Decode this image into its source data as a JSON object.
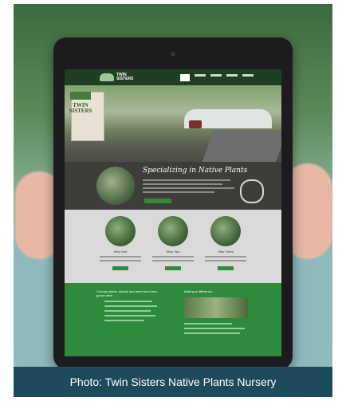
{
  "caption": "Photo: Twin Sisters Native Plants Nursery",
  "website": {
    "logo_text": "TWIN SISTERS",
    "sign_text": "TWIN SISTERS",
    "section_title": "Specializing in Native Plants",
    "steps": [
      {
        "label": "Step One"
      },
      {
        "label": "Step Two"
      },
      {
        "label": "Step Three"
      }
    ],
    "green_left_title": "Choose plants, shrubs and trees from here, grown here.",
    "green_right_title": "Making a difference..."
  },
  "colors": {
    "caption_bg": "#1d4b5c",
    "site_green": "#2e8b3e",
    "site_dark": "#3e3d3a"
  }
}
